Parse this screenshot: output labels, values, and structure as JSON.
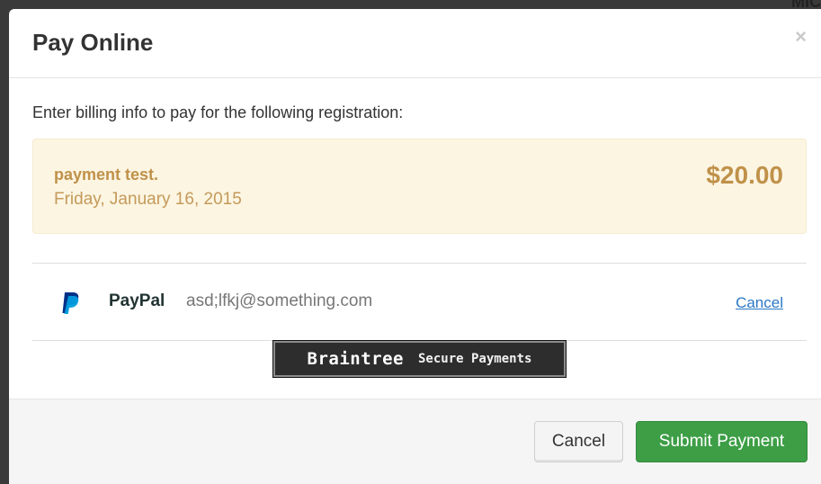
{
  "backdrop": {
    "text": "MIC"
  },
  "modal": {
    "title": "Pay Online",
    "close_label": "×",
    "intro": "Enter billing info to pay for the following registration:",
    "registration": {
      "name": "payment test.",
      "date": "Friday, January 16, 2015",
      "amount": "$20.00"
    },
    "payment_method": {
      "icon": "paypal-icon",
      "label": "PayPal",
      "email": "asd;lfkj@something.com",
      "cancel_label": "Cancel"
    },
    "badge": {
      "name": "Braintree",
      "tagline": "Secure Payments"
    },
    "footer": {
      "cancel_label": "Cancel",
      "submit_label": "Submit Payment"
    }
  },
  "colors": {
    "accent_gold": "#c0914a",
    "panel_bg": "#fcf5e2",
    "submit_green": "#3d9e46",
    "link_blue": "#2a78c5",
    "paypal_dark": "#003087",
    "paypal_light": "#009cde"
  }
}
